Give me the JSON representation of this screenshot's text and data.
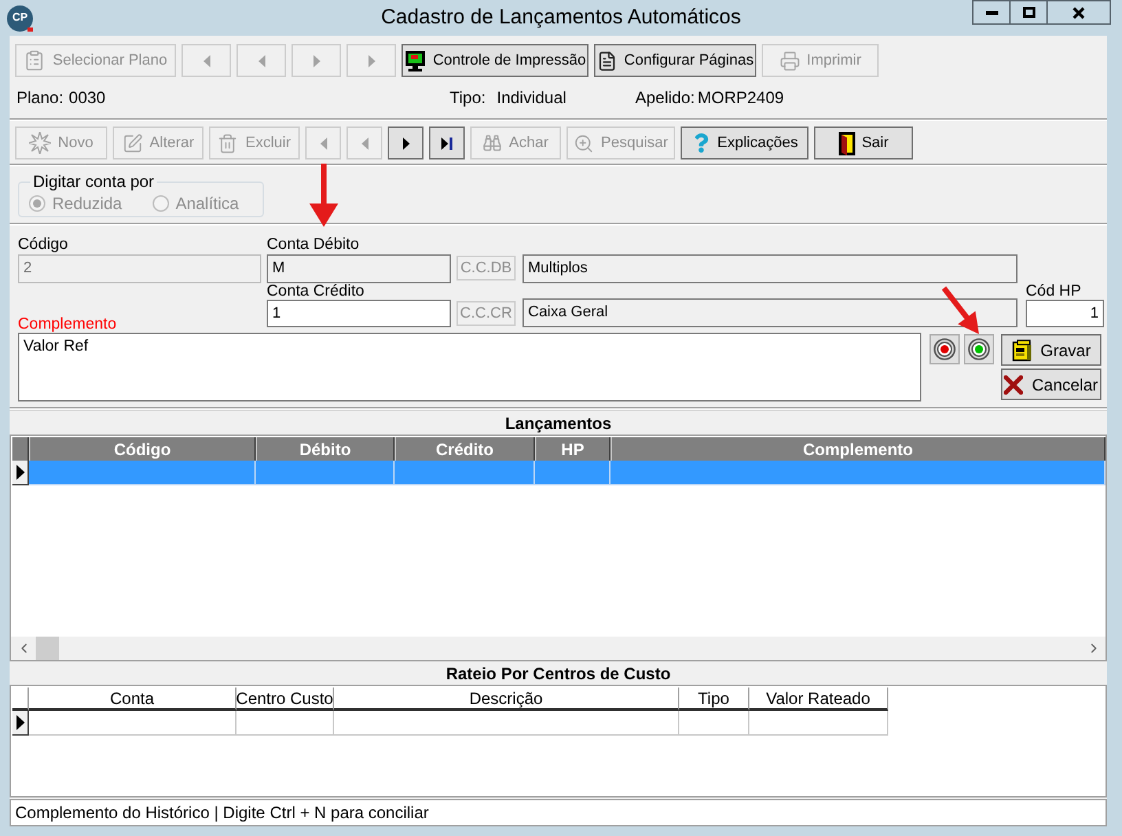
{
  "window": {
    "logo": "CP",
    "title": "Cadastro de Lançamentos Automáticos"
  },
  "plan_toolbar": [
    {
      "kind": "select",
      "label": "Selecionar Plano",
      "disabled": true
    },
    {
      "kind": "first",
      "disabled": true
    },
    {
      "kind": "prior",
      "disabled": true
    },
    {
      "kind": "next",
      "disabled": true
    },
    {
      "kind": "last",
      "disabled": true
    },
    {
      "kind": "print-control",
      "label": "Controle de Impressão",
      "disabled": false
    },
    {
      "kind": "page-setup",
      "label": "Configurar Páginas",
      "disabled": false
    },
    {
      "kind": "print",
      "label": "Imprimir",
      "disabled": true
    }
  ],
  "plan_info": [
    {
      "label": "Plano:",
      "value": "0030"
    },
    {
      "label": "Tipo:",
      "value": "Individual"
    },
    {
      "label": "Apelido:",
      "value": "MORP2409"
    }
  ],
  "record_toolbar": [
    {
      "kind": "new",
      "label": "Novo",
      "disabled": true
    },
    {
      "kind": "edit",
      "label": "Alterar",
      "disabled": true
    },
    {
      "kind": "delete",
      "label": "Excluir",
      "disabled": true
    },
    {
      "kind": "first",
      "disabled": true
    },
    {
      "kind": "prior",
      "disabled": true
    },
    {
      "kind": "next",
      "disabled": false
    },
    {
      "kind": "last",
      "disabled": false
    },
    {
      "kind": "find",
      "label": "Achar",
      "disabled": true
    },
    {
      "kind": "search",
      "label": "Pesquisar",
      "disabled": true
    },
    {
      "kind": "help",
      "label": "Explicações",
      "disabled": false
    },
    {
      "kind": "exit",
      "label": "Sair",
      "disabled": false
    }
  ],
  "account_entry": {
    "title": "Digitar conta por",
    "disabled": true,
    "options": [
      {
        "label": "Reduzida",
        "selected": true
      },
      {
        "label": "Analítica",
        "selected": false
      }
    ]
  },
  "form": {
    "code": {
      "label": "Código",
      "value": "2",
      "kind": "disabled"
    },
    "debit": {
      "label": "Conta Débito",
      "value": "M",
      "kind": "readonly",
      "button": {
        "label": "C.C.DB",
        "disabled": true
      },
      "description": {
        "value": "Multiplos",
        "kind": "readonly"
      }
    },
    "credit": {
      "label": "Conta Crédito",
      "value": "1",
      "kind": "input",
      "button": {
        "label": "C.C.CR",
        "disabled": true
      },
      "description": {
        "value": "Caixa Geral",
        "kind": "readonly"
      }
    },
    "hp": {
      "label": "Cód HP",
      "value": "1",
      "kind": "input"
    },
    "complement": {
      "label": "Complemento",
      "required": true,
      "value": "Valor Ref"
    }
  },
  "lamps": [
    {
      "color": "#e00000"
    },
    {
      "color": "#00c000"
    }
  ],
  "actions": [
    {
      "kind": "save",
      "label": "Gravar"
    },
    {
      "kind": "cancel",
      "label": "Cancelar"
    }
  ],
  "entries": {
    "title": "Lançamentos",
    "columns": [
      "Código",
      "Débito",
      "Crédito",
      "HP",
      "Complemento"
    ],
    "rows": [
      {
        "selected": true,
        "current": true
      }
    ]
  },
  "allocation": {
    "title": "Rateio Por Centros de Custo",
    "columns": [
      "Conta",
      "Centro Custo",
      "Descrição",
      "Tipo",
      "Valor Rateado"
    ],
    "rows": [
      {
        "selected": false,
        "current": true
      }
    ]
  },
  "status_bar": {
    "text": "Complemento do Histórico | Digite Ctrl + N para conciliar"
  }
}
